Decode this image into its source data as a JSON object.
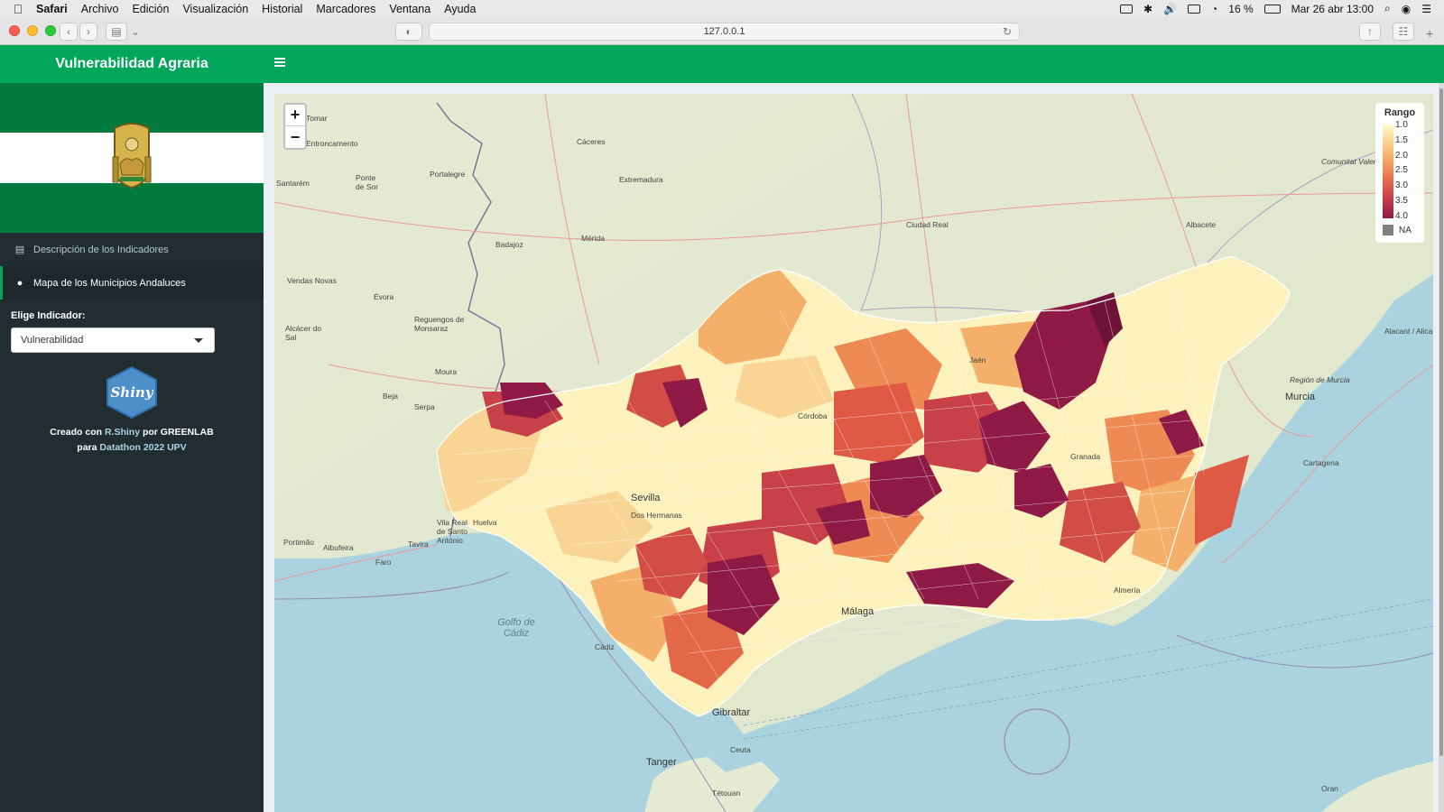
{
  "menubar": {
    "items": [
      "Safari",
      "Archivo",
      "Edición",
      "Visualización",
      "Historial",
      "Marcadores",
      "Ventana",
      "Ayuda"
    ],
    "battery": "16 %",
    "datetime": "Mar 26 abr  13:00"
  },
  "browser": {
    "url": "127.0.0.1"
  },
  "app": {
    "title": "Vulnerabilidad Agraria"
  },
  "sidebar": {
    "nav": [
      {
        "label": "Descripción de los Indicadores",
        "icon": "table-icon"
      },
      {
        "label": "Mapa de los Municipios Andaluces",
        "icon": "map-marker-icon"
      }
    ],
    "select_label": "Elige Indicador:",
    "select_value": "Vulnerabilidad",
    "shiny_logo": "Shiny",
    "credits_1a": "Creado con ",
    "credits_1b": "R.Shiny",
    "credits_1c": " por GREENLAB",
    "credits_2a": "para ",
    "credits_2b": "Datathon 2022 UPV"
  },
  "map": {
    "zoom_in": "+",
    "zoom_out": "−",
    "legend": {
      "title": "Rango",
      "ticks": [
        "1.0",
        "1.5",
        "2.0",
        "2.5",
        "3.0",
        "3.5",
        "4.0"
      ],
      "na_label": "NA",
      "colors": [
        "#fffcc8",
        "#fbd08a",
        "#f4a363",
        "#e56b4c",
        "#c43c4a",
        "#8e1a45"
      ]
    },
    "places": {
      "extremadura": "Extremadura",
      "caceres": "Cáceres",
      "badajoz": "Badajoz",
      "merida": "Mérida",
      "ciudad_real": "Ciudad Real",
      "albacete": "Albacete",
      "murcia": "Murcia",
      "region_murcia": "Región de Murcia",
      "cartagena": "Cartagena",
      "alicante": "Alacant / Alicante",
      "valenciana": "Comunitat Valenciana",
      "cordoba": "Córdoba",
      "sevilla": "Sevilla",
      "dos_hermanas": "Dos Hermanas",
      "malaga": "Málaga",
      "almeria": "Almería",
      "cadiz": "Cádiz",
      "golfo": "Golfo de Cádiz",
      "gibraltar": "Gibraltar",
      "ceuta": "Ceuta",
      "tanger": "Tanger",
      "tetouan": "Tétouan",
      "oran": "Oran",
      "faro": "Faro",
      "portimao": "Portimão",
      "albufeira": "Albufeira",
      "tavira": "Tavira",
      "vila_real": "Vila Real de Santo António",
      "evora": "Évora",
      "beja": "Beja",
      "serpa": "Serpa",
      "moura": "Moura",
      "reguengos": "Reguengos de Monsaraz",
      "portalegre": "Portalegre",
      "ponte_sor": "Ponte de Sor",
      "vendas_novas": "Vendas Novas",
      "alcacer": "Alcácer do Sal",
      "tomar": "Tomar",
      "entroncamento": "Entroncamento",
      "santarem": "Santarém",
      "granada": "Granada",
      "jaen": "Jaén",
      "huelva": "Huelva"
    }
  }
}
